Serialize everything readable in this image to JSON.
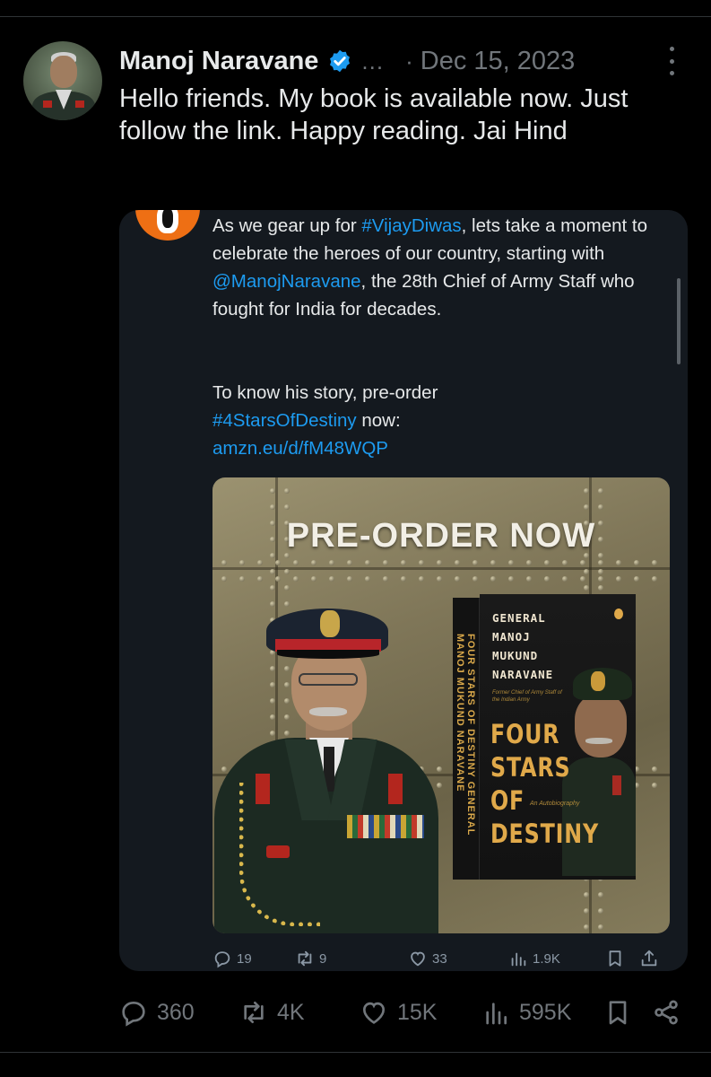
{
  "post": {
    "author_name": "Manoj Naravane",
    "ellipsis": "...",
    "separator": "·",
    "date": "Dec 15, 2023",
    "text": "Hello friends. My book is available now. Just follow the link. Happy reading. Jai Hind"
  },
  "quoted": {
    "para1_a": "As we gear up for ",
    "hashtag_vijay": "#VijayDiwas",
    "para1_b": ", lets take a moment to celebrate the heroes of our country, starting with ",
    "mention": "@ManojNaravane",
    "para1_c": ", the 28th Chief of Army Staff who fought for India for decades.",
    "para2_a": "To know his story, pre-order ",
    "hashtag_book": "#4StarsOfDestiny",
    "para2_b": " now:",
    "link": "amzn.eu/d/fM48WQP",
    "promo": {
      "headline": "PRE-ORDER NOW",
      "book_author_lines": [
        "GENERAL",
        "MANOJ",
        "MUKUND",
        "NARAVANE"
      ],
      "book_subtitle": "Former Chief of Army Staff of the Indian Army",
      "book_title_lines": [
        "FOUR",
        "STARS",
        "OF",
        "DESTINY"
      ],
      "book_tagline": "An Autobiography",
      "spine_text": "FOUR STARS OF DESTINY  GENERAL MANOJ MUKUND NARAVANE"
    },
    "stats": {
      "replies": "19",
      "reposts": "9",
      "likes": "33",
      "views": "1.9K"
    }
  },
  "actions": {
    "replies": "360",
    "reposts": "4K",
    "likes": "15K",
    "views": "595K"
  },
  "colors": {
    "background": "#000000",
    "text": "#e7e9ea",
    "muted": "#71767b",
    "link": "#1d9bf0",
    "verified": "#1d9bf0",
    "quote_card": "#14191f"
  },
  "icons": [
    "verified-badge-icon",
    "more-icon",
    "penguin-logo-icon",
    "reply-icon",
    "repost-icon",
    "like-icon",
    "views-icon",
    "bookmark-icon",
    "share-icon"
  ]
}
